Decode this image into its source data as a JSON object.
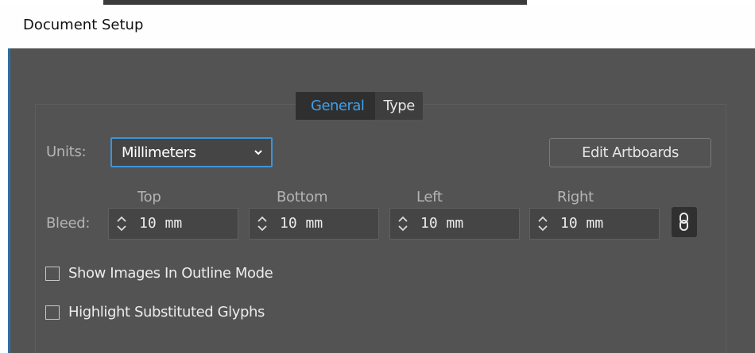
{
  "window": {
    "title": "Document Setup"
  },
  "tabs": [
    {
      "label": "General",
      "active": true
    },
    {
      "label": "Type",
      "active": false
    }
  ],
  "units": {
    "label": "Units:",
    "selected": "Millimeters"
  },
  "edit_artboards": {
    "label": "Edit Artboards"
  },
  "bleed": {
    "label": "Bleed:",
    "top": {
      "label": "Top",
      "value": "10 mm"
    },
    "bottom": {
      "label": "Bottom",
      "value": "10 mm"
    },
    "left": {
      "label": "Left",
      "value": "10 mm"
    },
    "right": {
      "label": "Right",
      "value": "10 mm"
    },
    "link_icon": "chain-link-icon"
  },
  "options": [
    {
      "label": "Show Images In Outline Mode",
      "checked": false
    },
    {
      "label": "Highlight Substituted Glyphs",
      "checked": false
    }
  ],
  "colors": {
    "panel": "#535353",
    "accent": "#3fa0ea",
    "field": "#454545"
  }
}
